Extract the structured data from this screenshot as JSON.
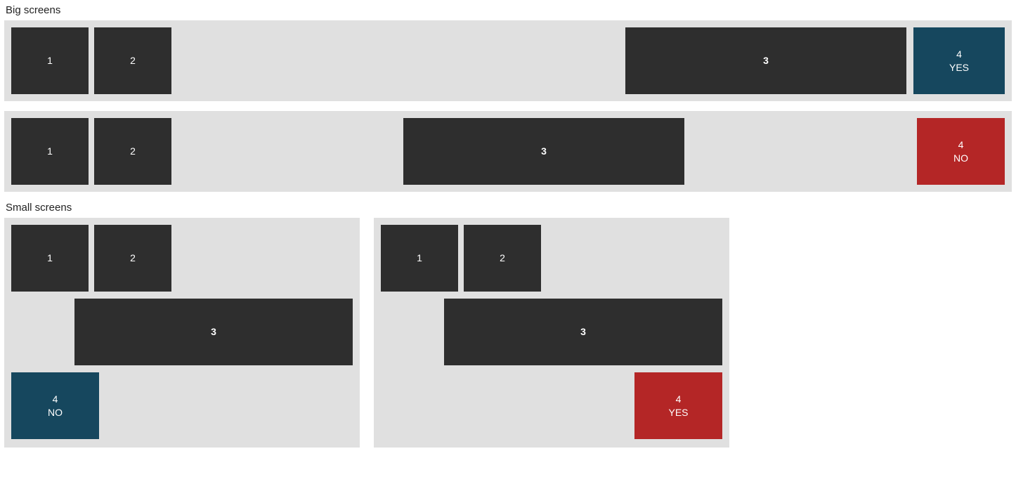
{
  "labels": {
    "big": "Big screens",
    "small": "Small screens"
  },
  "big1": {
    "b1": "1",
    "b2": "2",
    "b3": "3",
    "b4_num": "4",
    "b4_word": "YES"
  },
  "big2": {
    "b1": "1",
    "b2": "2",
    "b3": "3",
    "b4_num": "4",
    "b4_word": "NO"
  },
  "smallA": {
    "b1": "1",
    "b2": "2",
    "b3": "3",
    "b4_num": "4",
    "b4_word": "NO"
  },
  "smallB": {
    "b1": "1",
    "b2": "2",
    "b3": "3",
    "b4_num": "4",
    "b4_word": "YES"
  }
}
